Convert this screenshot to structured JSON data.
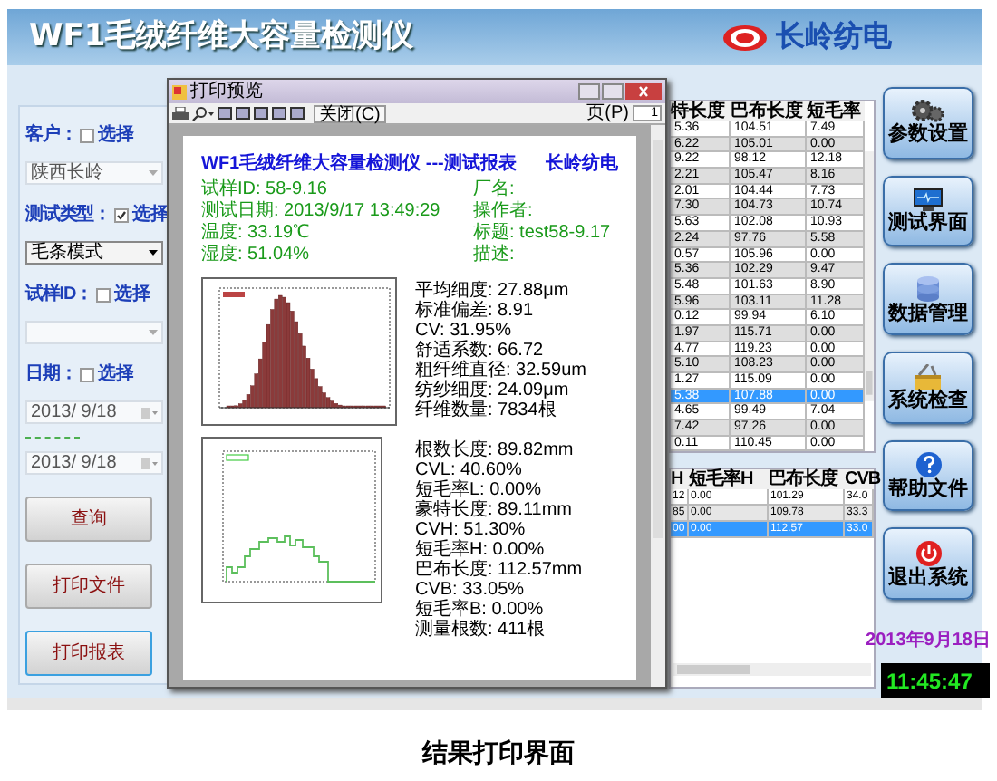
{
  "app": {
    "title": "WF1毛绒纤维大容量检测仪",
    "brand": "长岭纺电"
  },
  "filters": [
    {
      "label": "客户：",
      "checkbox_label": "选择",
      "checked": false,
      "fields": [
        {
          "kind": "select",
          "value": "陕西长岭",
          "enabled": false
        }
      ]
    },
    {
      "label": "测试类型：",
      "checkbox_label": "选择",
      "checked": true,
      "fields": [
        {
          "kind": "select",
          "value": "毛条模式",
          "enabled": true
        }
      ]
    },
    {
      "label": "试样ID：",
      "checkbox_label": "选择",
      "checked": false,
      "fields": [
        {
          "kind": "select",
          "enabled": false
        }
      ]
    },
    {
      "label": "日期：",
      "checkbox_label": "选择",
      "checked": false,
      "fields": [
        {
          "kind": "date",
          "value": "2013/ 9/18",
          "enabled": false
        },
        {
          "kind": "date",
          "value": "2013/ 9/18",
          "enabled": false
        }
      ]
    }
  ],
  "actions": [
    {
      "label": "查询",
      "focused": false
    },
    {
      "label": "打印文件",
      "focused": false
    },
    {
      "label": "打印报表",
      "focused": true
    }
  ],
  "preview": {
    "title": "打印预览",
    "close_button": "关闭(C)",
    "page_label": "页(P)",
    "page": "1",
    "report": {
      "title": "WF1毛绒纤维大容量检测仪 ---测试报表",
      "company": "长岭纺电",
      "info_left": [
        "试样ID: 58-9.16",
        "测试日期: 2013/9/17 13:49:29",
        "温度: 33.19℃",
        "湿度: 51.04%"
      ],
      "info_right": [
        "厂名:",
        "操作者:",
        "标题: test58-9.17",
        "描述:"
      ],
      "sections": [
        {
          "kind": "histogram",
          "stats": [
            "平均细度: 27.88μm",
            "标准偏差: 8.91",
            "CV: 31.95%",
            "舒适系数: 66.72",
            "粗纤维直径: 32.59um",
            "纺纱细度: 24.09μm",
            "纤维数量: 7834根"
          ]
        },
        {
          "kind": "line",
          "stats": [
            "根数长度: 89.82mm",
            "CVL: 40.60%",
            "短毛率L: 0.00%",
            "豪特长度: 89.11mm",
            "CVH: 51.30%",
            "短毛率H: 0.00%",
            "巴布长度: 112.57mm",
            "CVB: 33.05%",
            "短毛率B: 0.00%",
            "测量根数: 411根"
          ]
        }
      ]
    }
  },
  "table": {
    "columns": [
      "特长度",
      "巴布长度",
      "短毛率"
    ],
    "rows": [
      {
        "cells": [
          "5.36",
          "104.51",
          "7.49"
        ],
        "selected": false
      },
      {
        "cells": [
          "6.22",
          "105.01",
          "0.00"
        ],
        "selected": false
      },
      {
        "cells": [
          "9.22",
          "98.12",
          "12.18"
        ],
        "selected": false
      },
      {
        "cells": [
          "2.21",
          "105.47",
          "8.16"
        ],
        "selected": false
      },
      {
        "cells": [
          "2.01",
          "104.44",
          "7.73"
        ],
        "selected": false
      },
      {
        "cells": [
          "7.30",
          "104.73",
          "10.74"
        ],
        "selected": false
      },
      {
        "cells": [
          "5.63",
          "102.08",
          "10.93"
        ],
        "selected": false
      },
      {
        "cells": [
          "2.24",
          "97.76",
          "5.58"
        ],
        "selected": false
      },
      {
        "cells": [
          "0.57",
          "105.96",
          "0.00"
        ],
        "selected": false
      },
      {
        "cells": [
          "5.36",
          "102.29",
          "9.47"
        ],
        "selected": false
      },
      {
        "cells": [
          "5.48",
          "101.63",
          "8.90"
        ],
        "selected": false
      },
      {
        "cells": [
          "5.96",
          "103.11",
          "11.28"
        ],
        "selected": false
      },
      {
        "cells": [
          "0.12",
          "99.94",
          "6.10"
        ],
        "selected": false
      },
      {
        "cells": [
          "1.97",
          "115.71",
          "0.00"
        ],
        "selected": false
      },
      {
        "cells": [
          "4.77",
          "119.23",
          "0.00"
        ],
        "selected": false
      },
      {
        "cells": [
          "5.10",
          "108.23",
          "0.00"
        ],
        "selected": false
      },
      {
        "cells": [
          "1.27",
          "115.09",
          "0.00"
        ],
        "selected": false
      },
      {
        "cells": [
          "5.38",
          "107.88",
          "0.00"
        ],
        "selected": true
      },
      {
        "cells": [
          "4.65",
          "99.49",
          "7.04"
        ],
        "selected": false
      },
      {
        "cells": [
          "7.42",
          "97.26",
          "0.00"
        ],
        "selected": false
      },
      {
        "cells": [
          "0.11",
          "110.45",
          "0.00"
        ],
        "selected": false
      }
    ]
  },
  "table_2": {
    "columns": [
      "H",
      "短毛率H",
      "巴布长度",
      "CVB"
    ],
    "rows": [
      {
        "cells": [
          "12",
          "0.00",
          "101.29",
          "34.0"
        ],
        "selected": false
      },
      {
        "cells": [
          "85",
          "0.00",
          "109.78",
          "33.3"
        ],
        "selected": false
      },
      {
        "cells": [
          "00",
          "0.00",
          "112.57",
          "33.0"
        ],
        "selected": true
      }
    ]
  },
  "menu": [
    {
      "label": "参数设置",
      "kind": "gear"
    },
    {
      "label": "测试界面",
      "kind": "monitor"
    },
    {
      "label": "数据管理",
      "kind": "database"
    },
    {
      "label": "系统检查",
      "kind": "tools"
    },
    {
      "label": "帮助文件",
      "kind": "help"
    },
    {
      "label": "退出系统",
      "kind": "power"
    }
  ],
  "date": "2013年9月18日",
  "clock": "11:45:47",
  "caption": "结果打印界面"
}
